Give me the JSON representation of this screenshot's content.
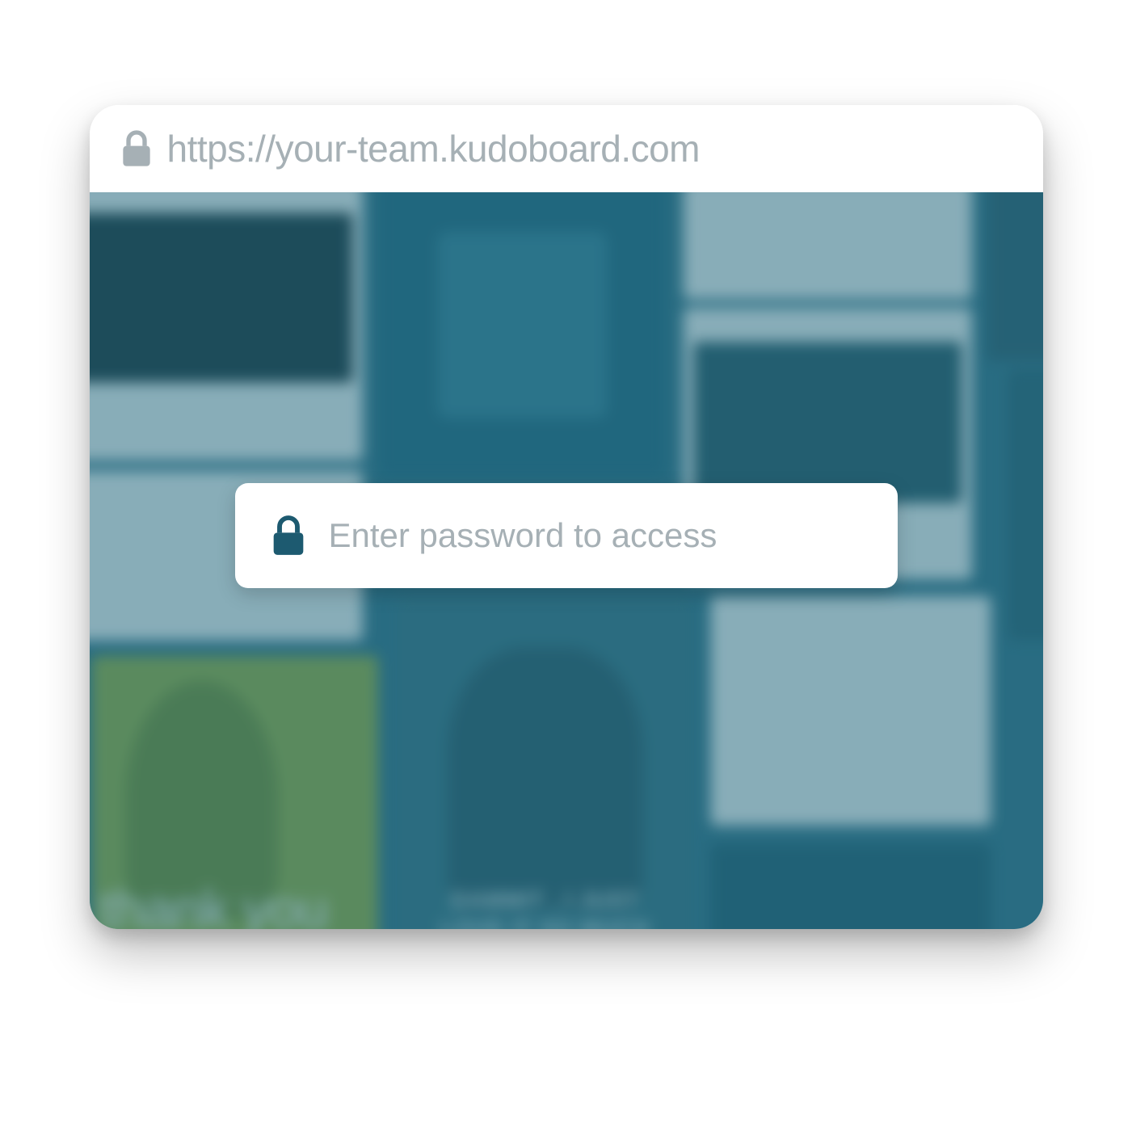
{
  "url": "https://your-team.kudoboard.com",
  "password_prompt": {
    "placeholder": "Enter password to access"
  },
  "background_cards": {
    "thank_you_text": "thank you",
    "caption_text": "DAMMIT , I JUST\nLOVE IT SO MUCH"
  },
  "colors": {
    "url_text": "#a6b0b5",
    "accent": "#1d5a70",
    "content_bg": "#256b82"
  }
}
